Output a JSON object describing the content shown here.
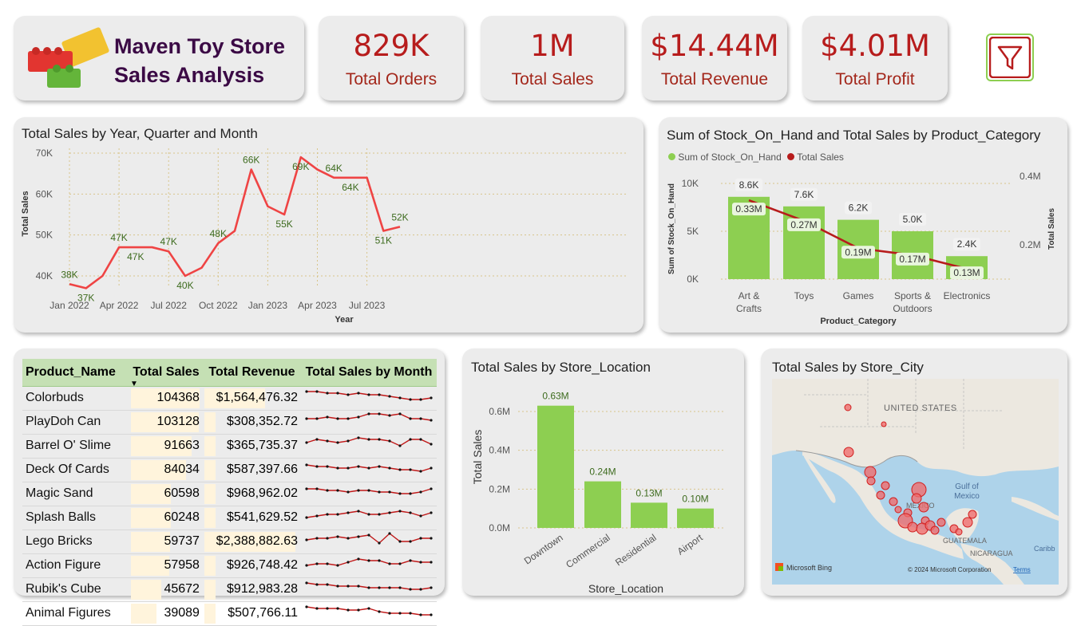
{
  "header": {
    "title_line1": "Maven Toy Store",
    "title_line2": "Sales Analysis",
    "filter_icon": "filter-icon",
    "logo_icon": "lego-bricks-icon"
  },
  "kpis": [
    {
      "value": "829K",
      "label": "Total Orders"
    },
    {
      "value": "1M",
      "label": "Total Sales"
    },
    {
      "value": "$14.44M",
      "label": "Total Revenue"
    },
    {
      "value": "$4.01M",
      "label": "Total Profit"
    }
  ],
  "line_chart": {
    "title": "Total Sales by Year, Quarter and Month",
    "xlabel": "Year",
    "ylabel": "Total Sales",
    "y_ticks": [
      "40K",
      "50K",
      "60K",
      "70K"
    ],
    "x_ticks": [
      "Jan 2022",
      "Apr 2022",
      "Jul 2022",
      "Oct 2022",
      "Jan 2023",
      "Apr 2023",
      "Jul 2023"
    ]
  },
  "combo_chart": {
    "title": "Sum of Stock_On_Hand and Total Sales by Product_Category",
    "legend": [
      "Sum of Stock_On_Hand",
      "Total Sales"
    ],
    "xlabel": "Product_Category",
    "ylabel_left": "Sum of Stock_On_Hand",
    "ylabel_right": "Total Sales",
    "y_left_ticks": [
      "0K",
      "5K",
      "10K"
    ],
    "y_right_ticks": [
      "0.2M",
      "0.4M"
    ]
  },
  "table": {
    "headers": [
      "Product_Name",
      "Total Sales",
      "Total Revenue",
      "Total Sales by Month"
    ],
    "rows": [
      {
        "name": "Colorbuds",
        "sales": "104368",
        "revenue": "$1,564,476.32"
      },
      {
        "name": "PlayDoh Can",
        "sales": "103128",
        "revenue": "$308,352.72"
      },
      {
        "name": "Barrel O' Slime",
        "sales": "91663",
        "revenue": "$365,735.37"
      },
      {
        "name": "Deck Of Cards",
        "sales": "84034",
        "revenue": "$587,397.66"
      },
      {
        "name": "Magic Sand",
        "sales": "60598",
        "revenue": "$968,962.02"
      },
      {
        "name": "Splash Balls",
        "sales": "60248",
        "revenue": "$541,629.52"
      },
      {
        "name": "Lego Bricks",
        "sales": "59737",
        "revenue": "$2,388,882.63"
      },
      {
        "name": "Action Figure",
        "sales": "57958",
        "revenue": "$926,748.42"
      },
      {
        "name": "Rubik's Cube",
        "sales": "45672",
        "revenue": "$912,983.28"
      },
      {
        "name": "Animal Figures",
        "sales": "39089",
        "revenue": "$507,766.11"
      }
    ]
  },
  "bar_chart": {
    "title": "Total Sales by Store_Location",
    "xlabel": "Store_Location",
    "ylabel": "Total Sales",
    "y_ticks": [
      "0.0M",
      "0.2M",
      "0.4M",
      "0.6M"
    ]
  },
  "map": {
    "title": "Total Sales by Store_City",
    "labels": [
      "UNITED STATES",
      "Gulf of Mexico",
      "MEXICO",
      "GUATEMALA",
      "NICARAGUA",
      "Caribb"
    ],
    "bing_logo": "Microsoft Bing",
    "copyright": "© 2024 Microsoft Corporation",
    "terms": "Terms"
  },
  "colors": {
    "accent_red": "#b71c1c",
    "line_red": "#ef4444",
    "bar_green": "#8dcf51",
    "title_purple": "#3b0a45",
    "header_green": "#c5e0b4"
  },
  "chart_data": [
    {
      "type": "line",
      "title": "Total Sales by Year, Quarter and Month",
      "xlabel": "Year",
      "ylabel": "Total Sales",
      "ylim": [
        37000,
        70000
      ],
      "x": [
        "2022-01",
        "2022-02",
        "2022-03",
        "2022-04",
        "2022-05",
        "2022-06",
        "2022-07",
        "2022-08",
        "2022-09",
        "2022-10",
        "2022-11",
        "2022-12",
        "2023-01",
        "2023-02",
        "2023-03",
        "2023-04",
        "2023-05",
        "2023-06",
        "2023-07",
        "2023-08",
        "2023-09"
      ],
      "series": [
        {
          "name": "Total Sales",
          "values": [
            38000,
            37000,
            40000,
            47000,
            47000,
            47000,
            46000,
            40000,
            42000,
            48000,
            51000,
            66000,
            57000,
            55000,
            69000,
            66000,
            64000,
            64000,
            64000,
            51000,
            52000
          ]
        }
      ],
      "labels": [
        {
          "i": 0,
          "text": "38K"
        },
        {
          "i": 1,
          "text": "37K"
        },
        {
          "i": 3,
          "text": "47K"
        },
        {
          "i": 4,
          "text": "47K"
        },
        {
          "i": 6,
          "text": "47K"
        },
        {
          "i": 7,
          "text": "40K"
        },
        {
          "i": 9,
          "text": "48K"
        },
        {
          "i": 11,
          "text": "66K"
        },
        {
          "i": 13,
          "text": "55K"
        },
        {
          "i": 14,
          "text": "69K"
        },
        {
          "i": 16,
          "text": "64K"
        },
        {
          "i": 17,
          "text": "64K"
        },
        {
          "i": 19,
          "text": "51K"
        },
        {
          "i": 20,
          "text": "52K"
        }
      ]
    },
    {
      "type": "bar",
      "title": "Sum of Stock_On_Hand and Total Sales by Product_Category",
      "categories": [
        "Art & Crafts",
        "Toys",
        "Games",
        "Sports & Outdoors",
        "Electronics"
      ],
      "series": [
        {
          "name": "Sum of Stock_On_Hand",
          "values": [
            8600,
            7600,
            6200,
            5000,
            2400
          ],
          "labels": [
            "8.6K",
            "7.6K",
            "6.2K",
            "5.0K",
            "2.4K"
          ],
          "axis": "left"
        },
        {
          "name": "Total Sales",
          "values": [
            0.33,
            0.27,
            0.19,
            0.17,
            0.13
          ],
          "labels": [
            "0.33M",
            "0.27M",
            "0.19M",
            "0.17M",
            "0.13M"
          ],
          "axis": "right",
          "render": "line"
        }
      ],
      "ylim_left": [
        0,
        11000
      ],
      "ylim_right_millions": [
        0.1,
        0.42
      ]
    },
    {
      "type": "bar",
      "title": "Total Sales by Store_Location",
      "categories": [
        "Downtown",
        "Commercial",
        "Residential",
        "Airport"
      ],
      "values": [
        0.63,
        0.24,
        0.13,
        0.1
      ],
      "labels": [
        "0.63M",
        "0.24M",
        "0.13M",
        "0.10M"
      ],
      "xlabel": "Store_Location",
      "ylabel": "Total Sales",
      "ylim_millions": [
        0,
        0.7
      ]
    },
    {
      "type": "line",
      "title": "Total Sales by Month",
      "rows": [
        [
          7,
          7,
          6,
          6,
          5,
          6,
          5,
          5,
          4,
          3,
          2,
          2,
          3
        ],
        [
          5,
          5,
          6,
          5,
          5,
          6,
          8,
          8,
          7,
          8,
          5,
          5,
          4
        ],
        [
          5,
          7,
          6,
          5,
          6,
          8,
          7,
          7,
          6,
          3,
          7,
          7,
          4
        ],
        [
          6,
          5,
          5,
          4,
          4,
          5,
          4,
          5,
          4,
          3,
          3,
          2,
          4
        ],
        [
          6,
          6,
          5,
          5,
          4,
          5,
          5,
          4,
          4,
          3,
          3,
          4,
          6
        ],
        [
          3,
          4,
          5,
          5,
          6,
          7,
          5,
          5,
          6,
          7,
          6,
          4,
          6
        ],
        [
          4,
          5,
          5,
          6,
          5,
          6,
          7,
          2,
          8,
          3,
          3,
          5,
          5
        ],
        [
          3,
          4,
          4,
          3,
          5,
          7,
          6,
          6,
          4,
          4,
          6,
          5,
          5
        ],
        [
          7,
          6,
          6,
          5,
          5,
          5,
          4,
          4,
          4,
          4,
          3,
          3,
          4
        ],
        [
          7,
          6,
          6,
          6,
          5,
          5,
          6,
          4,
          3,
          3,
          3,
          2,
          2
        ]
      ]
    }
  ]
}
